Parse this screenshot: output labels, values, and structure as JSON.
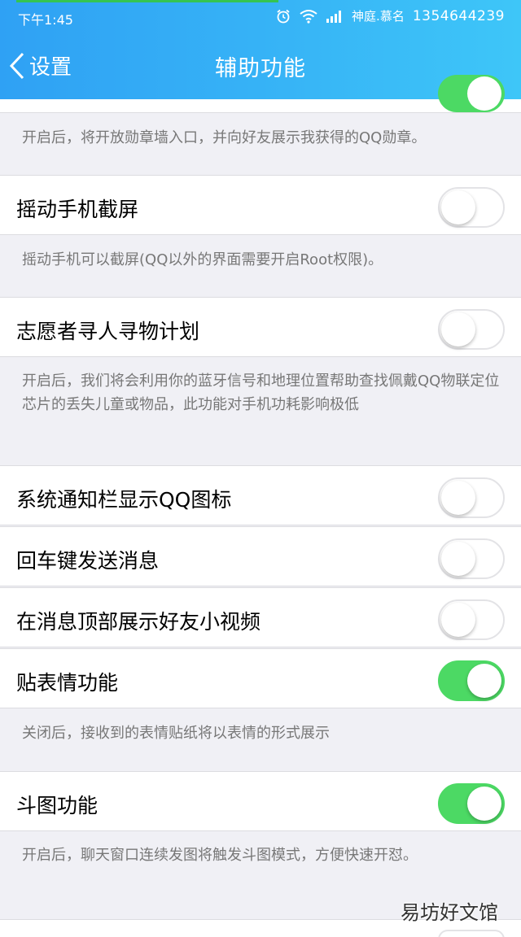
{
  "status_bar": {
    "time": "下午1:45",
    "carrier": "神庭.慕名",
    "phone": "1354644239",
    "icons": [
      "alarm-icon",
      "wifi-icon",
      "signal-icon"
    ]
  },
  "nav": {
    "back_label": "设置",
    "title": "辅助功能"
  },
  "top_desc": "开启后，将开放勋章墙入口，并向好友展示我获得的QQ勋章。",
  "settings": [
    {
      "label": "摇动手机截屏",
      "on": false
    },
    {
      "label": "志愿者寻人寻物计划",
      "on": false
    },
    {
      "label": "系统通知栏显示QQ图标",
      "on": false
    },
    {
      "label": "回车键发送消息",
      "on": false
    },
    {
      "label": "在消息顶部展示好友小视频",
      "on": false
    },
    {
      "label": "贴表情功能",
      "on": true
    },
    {
      "label": "斗图功能",
      "on": true
    }
  ],
  "descriptions": {
    "shake": "摇动手机可以截屏(QQ以外的界面需要开启Root权限)。",
    "volunteer": "开启后，我们将会利用你的蓝牙信号和地理位置帮助查找佩戴QQ物联定位芯片的丢失儿童或物品，此功能对手机功耗影响极低",
    "sticker": "关闭后，接收到的表情贴纸将以表情的形式展示",
    "doutu": "开启后，聊天窗口连续发图将触发斗图模式，方便快速开怼。"
  },
  "colors": {
    "header_gradient_start": "#2fa1f4",
    "header_gradient_end": "#3ec6f8",
    "toggle_on": "#4cd964"
  },
  "watermark": "易坊好文馆"
}
